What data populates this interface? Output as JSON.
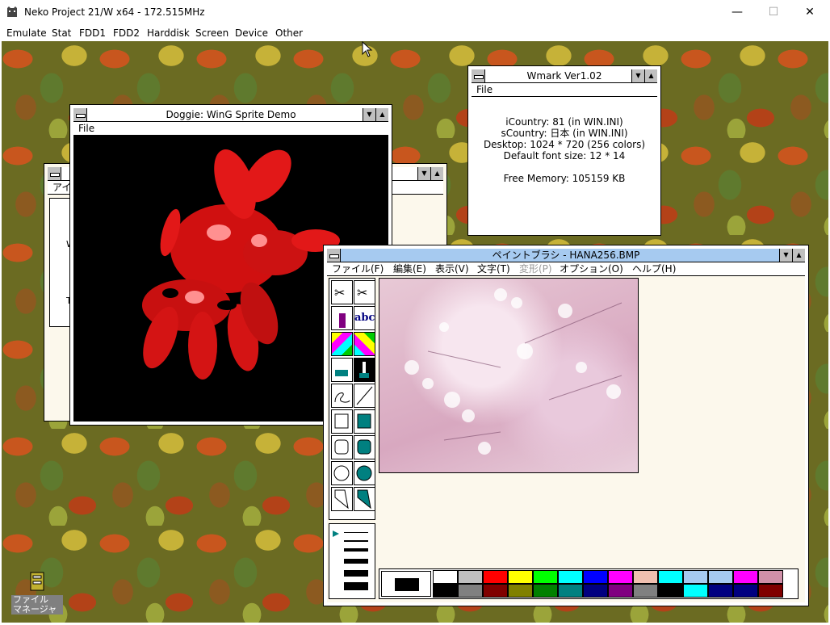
{
  "host": {
    "title": "Neko Project 21/W x64 - 172.515MHz",
    "controls": {
      "minimize": "—",
      "maximize": "☐",
      "close": "✕"
    },
    "menu": [
      "Emulate",
      "Stat",
      "FDD1",
      "FDD2",
      "Harddisk",
      "Screen",
      "Device",
      "Other"
    ]
  },
  "doggie": {
    "title": "Doggie: WinG Sprite Demo",
    "menu_file": "File"
  },
  "wmark": {
    "title": "Wmark Ver1.02",
    "menu_file": "File",
    "lines": [
      "iCountry: 81 (in WIN.INI)",
      "sCountry: 日本 (in WIN.INI)",
      "Desktop: 1024 * 720 (256 colors)",
      "Default font size: 12 * 14",
      "",
      "Free Memory: 105159 KB"
    ]
  },
  "behind_window": {
    "menu_fragment": "アイ",
    "text_w": "W",
    "text_t": "T"
  },
  "paintbrush": {
    "title": "ペイントブラシ - HANA256.BMP",
    "menu": [
      "ファイル(F)",
      "編集(E)",
      "表示(V)",
      "文字(T)",
      "変形(P)",
      "オプション(O)",
      "ヘルプ(H)"
    ],
    "abc_tool": "abc",
    "palette": [
      "#ffffff",
      "#c0c0c0",
      "#ff0000",
      "#ffff00",
      "#00ff00",
      "#00ffff",
      "#0000ff",
      "#ff00ff",
      "#f0c0b0",
      "#00ffff",
      "#a6caf0",
      "#a6caf0",
      "#ff00ff",
      "#d090a8",
      "#000000",
      "#808080",
      "#800000",
      "#808000",
      "#008000",
      "#008080",
      "#000080",
      "#800080",
      "#808080",
      "#000000",
      "#00ffff",
      "#000080",
      "#000080",
      "#800000"
    ]
  },
  "desktop_icon": {
    "label_line1": "ファイル",
    "label_line2": "マネージャ"
  }
}
